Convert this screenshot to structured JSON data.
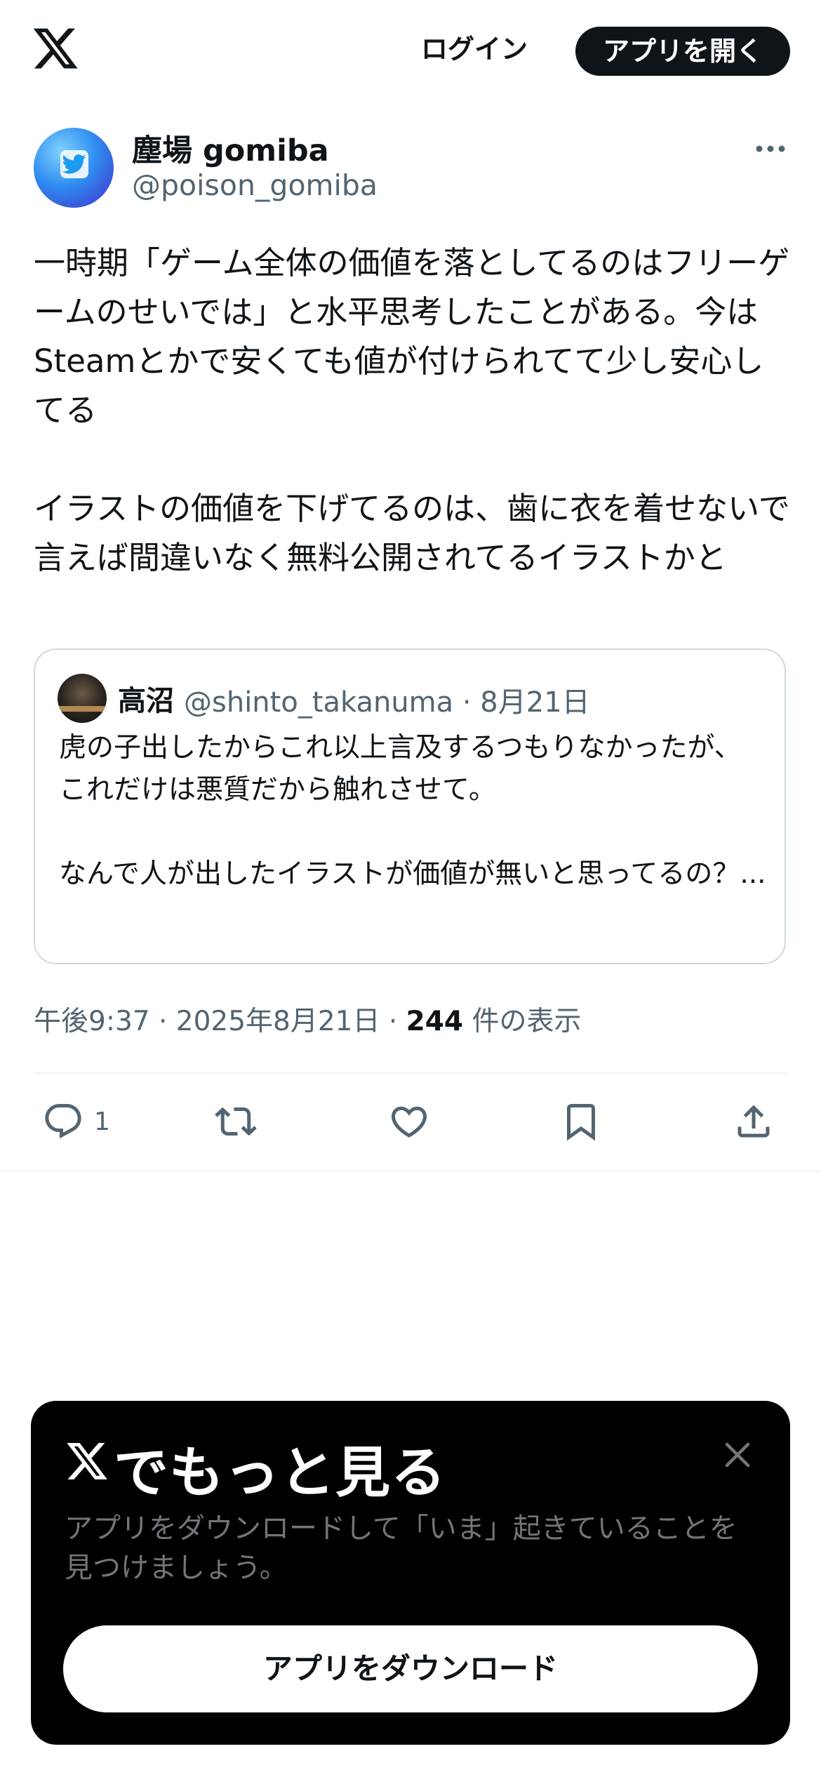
{
  "header": {
    "logo_icon": "x-logo-icon",
    "login_label": "ログイン",
    "open_app_label": "アプリを開く"
  },
  "tweet": {
    "author_name": "塵場 gomiba",
    "author_handle": "@poison_gomiba",
    "text": "一時期「ゲーム全体の価値を落としてるのはフリーゲームのせいでは」と水平思考したことがある。今はSteamとかで安くても値が付けられてて少し安心してる\n\nイラストの価値を下げてるのは、歯に衣を着せないで言えば間違いなく無料公開されてるイラストかと",
    "quoted": {
      "author_name": "高沼",
      "author_handle": "@shinto_takanuma · 8月21日",
      "text": "虎の子出したからこれ以上言及するつもりなかったが、これだけは悪質だから触れさせて。\n\nなんで人が出したイラストが価値が無いと思ってるの？..."
    },
    "meta": {
      "time_date": "午後9:37 · 2025年8月21日 · ",
      "views_count": "244",
      "views_label": " 件の表示"
    },
    "actions": {
      "reply_count": "1"
    }
  },
  "promo": {
    "title": "でもっと見る",
    "description": "アプリをダウンロードして「いま」起きていることを見つけましょう。",
    "download_label": "アプリをダウンロード"
  },
  "colors": {
    "text_primary": "#0f1419",
    "text_secondary": "#536471",
    "border": "#cfd9de",
    "sheet_bg": "#000000"
  }
}
